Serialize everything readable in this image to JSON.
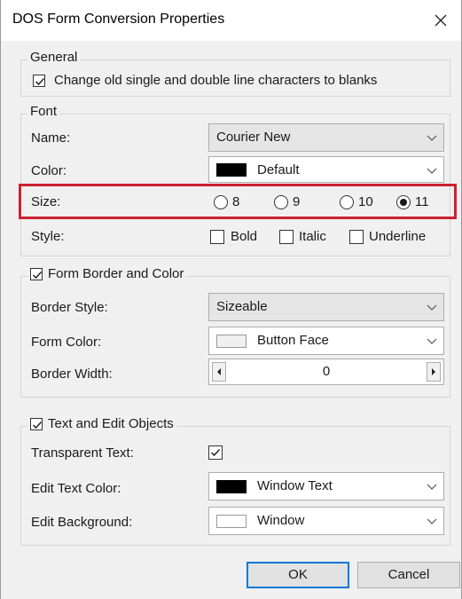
{
  "window": {
    "title": "DOS Form Conversion Properties"
  },
  "general": {
    "legend": "General",
    "change_lines_label": "Change old single and double line characters to blanks",
    "change_lines_checked": true
  },
  "font": {
    "legend": "Font",
    "name_label": "Name:",
    "name_value": "Courier New",
    "color_label": "Color:",
    "color_value": "Default",
    "color_swatch": "#000000",
    "size_label": "Size:",
    "size_options": [
      "8",
      "9",
      "10",
      "11"
    ],
    "size_selected": "11",
    "style_label": "Style:",
    "style_bold": "Bold",
    "style_italic": "Italic",
    "style_underline": "Underline"
  },
  "border": {
    "legend": "Form Border and Color",
    "enabled": true,
    "border_style_label": "Border Style:",
    "border_style_value": "Sizeable",
    "form_color_label": "Form Color:",
    "form_color_value": "Button Face",
    "form_color_swatch": "#f0f0f0",
    "border_width_label": "Border Width:",
    "border_width_value": "0"
  },
  "text_objects": {
    "legend": "Text and Edit Objects",
    "enabled": true,
    "transparent_label": "Transparent Text:",
    "transparent_checked": true,
    "edit_text_color_label": "Edit Text Color:",
    "edit_text_color_value": "Window Text",
    "edit_text_color_swatch": "#000000",
    "edit_background_label": "Edit Background:",
    "edit_background_value": "Window",
    "edit_background_swatch": "#ffffff"
  },
  "buttons": {
    "ok": "OK",
    "cancel": "Cancel"
  },
  "colors": {
    "highlight": "#cc2030",
    "default_button_border": "#0078d7"
  }
}
